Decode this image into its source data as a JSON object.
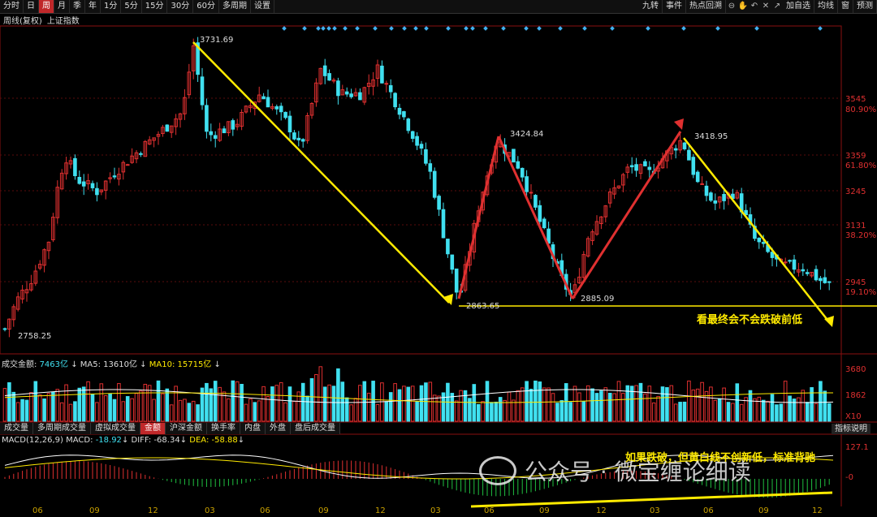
{
  "toolbar": {
    "items": [
      "分时",
      "日",
      "周",
      "月",
      "季",
      "年",
      "1分",
      "5分",
      "15分",
      "30分",
      "60分",
      "多周期",
      "设置"
    ],
    "active": "周",
    "right": [
      "九转",
      "事件",
      "热点回溯",
      "加自选",
      "均线",
      "窗",
      "预测"
    ]
  },
  "title": {
    "mode": "周线(复权)",
    "index": "上证指数"
  },
  "price_axis": [
    "3545",
    "80.90%",
    "3359",
    "61.80%",
    "3245",
    "3131",
    "38.20%",
    "2945",
    "19.10%"
  ],
  "annotations": {
    "high": "3731.69",
    "low_start": "2758.25",
    "low1": "2863.65",
    "peak2": "3424.84",
    "low2": "2885.09",
    "peak3": "3418.95",
    "note1": "看最终会不会跌破前低",
    "note2": "如果跌破，但黄白线不创新低，标准背驰"
  },
  "volume": {
    "label": "成交金额:",
    "value": "7463亿",
    "ma5_label": "MA5:",
    "ma5": "13610亿",
    "ma10_label": "MA10:",
    "ma10": "15715亿",
    "axis": [
      "3680",
      "1862",
      "X10"
    ]
  },
  "tabs": [
    "成交量",
    "多周期成交量",
    "虚拟成交量",
    "金额",
    "沪深金额",
    "换手率",
    "内盘",
    "外盘",
    "盘后成交量"
  ],
  "active_tab": "金额",
  "indicator_button": "指标说明",
  "macd": {
    "label": "MACD(12,26,9)",
    "macd_label": "MACD:",
    "macd": "-18.92",
    "diff_label": "DIFF:",
    "diff": "-68.34",
    "dea_label": "DEA:",
    "dea": "-58.88",
    "axis": [
      "127.1",
      "-0"
    ]
  },
  "watermark": "公众号 · 微宝缠论细读",
  "x_axis": [
    "06",
    "09",
    "12",
    "03",
    "06",
    "09",
    "12",
    "03",
    "06",
    "09",
    "12",
    "03",
    "06",
    "09",
    "12"
  ],
  "colors": {
    "up": "#e03030",
    "down": "#40e0f0",
    "yellow": "#ffea00",
    "accent": "#c0282a"
  }
}
